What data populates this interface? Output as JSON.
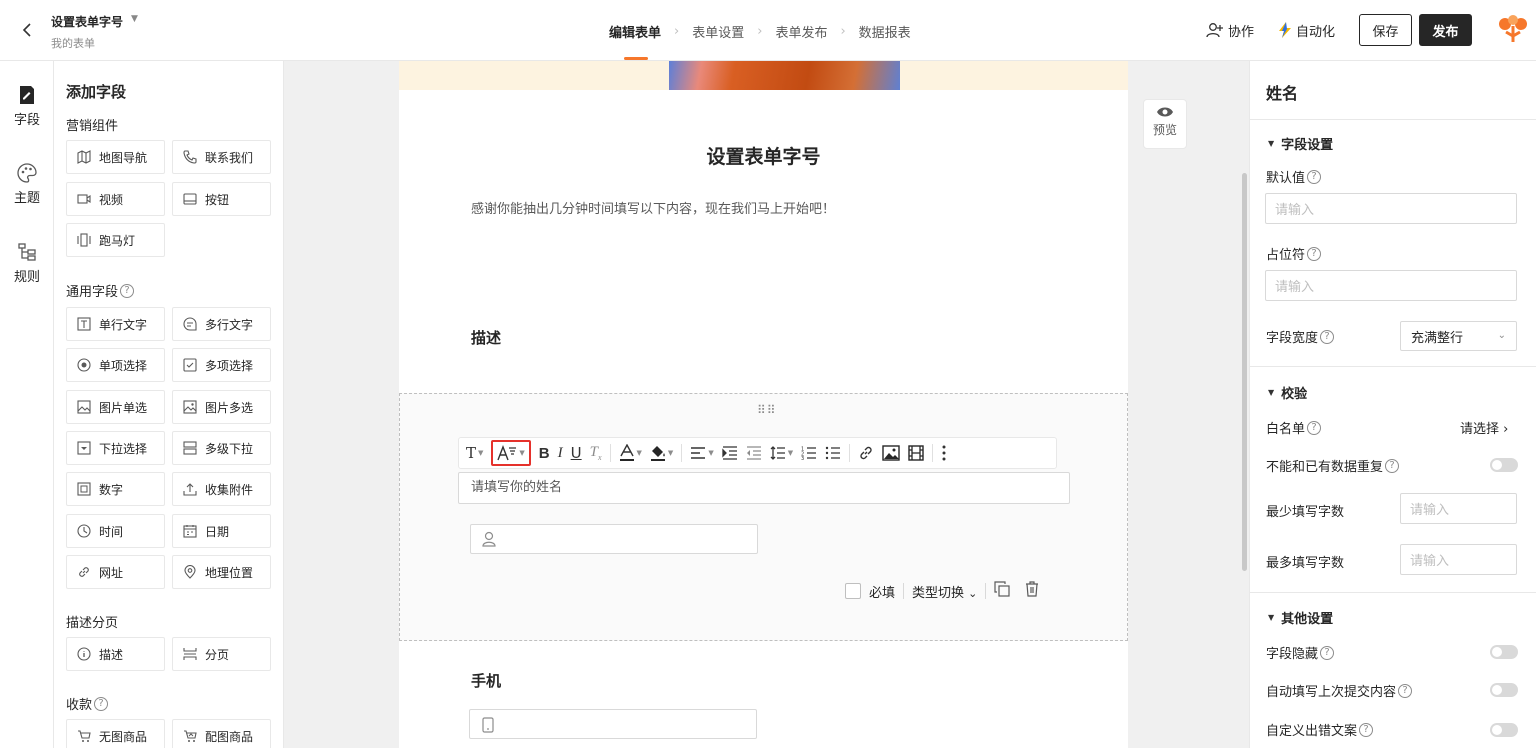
{
  "header": {
    "back_icon": "arrow-left-icon",
    "form_title": "设置表单字号",
    "form_subtitle": "我的表单",
    "steps": [
      "编辑表单",
      "表单设置",
      "表单发布",
      "数据报表"
    ],
    "active_step": "编辑表单",
    "collaborate_label": "协作",
    "automation_label": "自动化",
    "save_label": "保存",
    "publish_label": "发布",
    "accent_color": "#f6772b"
  },
  "rail": {
    "items": [
      {
        "label": "字段",
        "icon": "form-field-icon"
      },
      {
        "label": "主题",
        "icon": "palette-icon"
      },
      {
        "label": "规则",
        "icon": "rule-icon"
      }
    ]
  },
  "field_panel": {
    "title": "添加字段",
    "groups": {
      "marketing": {
        "title": "营销组件",
        "items": [
          "地图导航",
          "联系我们",
          "视频",
          "按钮",
          "跑马灯"
        ]
      },
      "general": {
        "title": "通用字段",
        "items": [
          "单行文字",
          "多行文字",
          "单项选择",
          "多项选择",
          "图片单选",
          "图片多选",
          "下拉选择",
          "多级下拉",
          "数字",
          "收集附件",
          "时间",
          "日期",
          "网址",
          "地理位置"
        ]
      },
      "desc_page": {
        "title": "描述分页",
        "items": [
          "描述",
          "分页"
        ]
      },
      "payment": {
        "title": "收款",
        "items": [
          "无图商品",
          "配图商品"
        ]
      }
    }
  },
  "canvas": {
    "form_title": "设置表单字号",
    "form_description": "感谢你能抽出几分钟时间填写以下内容，现在我们马上开始吧！",
    "description_label": "描述",
    "field_label_value": "请填写你的姓名",
    "required_label": "必填",
    "type_switch_label": "类型切换",
    "phone_label": "手机",
    "preview_label": "预览"
  },
  "right_panel": {
    "title": "姓名",
    "field_settings": {
      "title": "字段设置",
      "default_value_label": "默认值",
      "default_value_placeholder": "请输入",
      "placeholder_label": "占位符",
      "placeholder_placeholder": "请输入",
      "width_label": "字段宽度",
      "width_value": "充满整行"
    },
    "validation": {
      "title": "校验",
      "whitelist_label": "白名单",
      "whitelist_value": "请选择",
      "no_duplicate_label": "不能和已有数据重复",
      "min_chars_label": "最少填写字数",
      "min_chars_placeholder": "请输入",
      "max_chars_label": "最多填写字数",
      "max_chars_placeholder": "请输入"
    },
    "other": {
      "title": "其他设置",
      "hide_label": "字段隐藏",
      "autofill_label": "自动填写上次提交内容",
      "custom_error_label": "自定义出错文案"
    }
  }
}
